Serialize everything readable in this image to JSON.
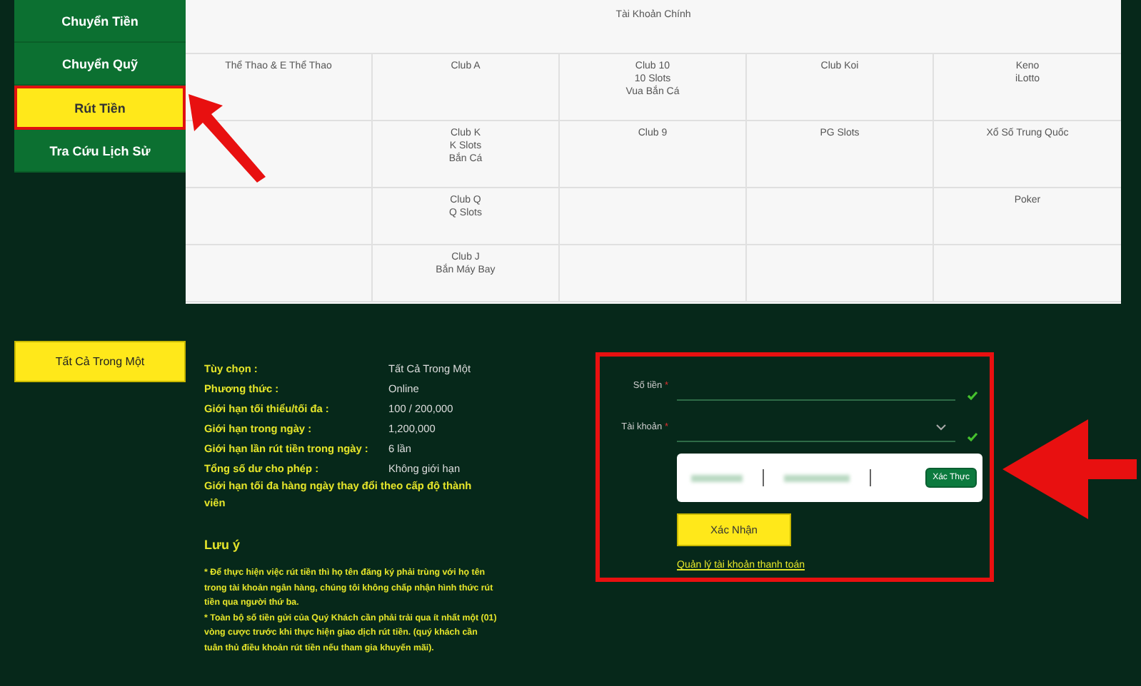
{
  "sidebar": {
    "items": [
      {
        "label": "Chuyển Tiền",
        "selected": false
      },
      {
        "label": "Chuyển Quỹ",
        "selected": false
      },
      {
        "label": "Rút Tiền",
        "selected": true
      },
      {
        "label": "Tra Cứu Lịch Sử",
        "selected": false
      }
    ]
  },
  "wallets": {
    "title": "Tài Khoản Chính",
    "rows": [
      [
        [
          "Thể Thao & E Thể Thao"
        ],
        [
          "Club A"
        ],
        [
          "Club 10",
          "10 Slots",
          "Vua Bắn Cá"
        ],
        [
          "Club Koi"
        ],
        [
          "Keno",
          "iLotto"
        ]
      ],
      [
        [],
        [
          "Club K",
          "K Slots",
          "Bắn Cá"
        ],
        [
          "Club 9"
        ],
        [
          "PG Slots"
        ],
        [
          "Xổ Số Trung Quốc"
        ]
      ],
      [
        [],
        [
          "Club Q",
          "Q Slots"
        ],
        [],
        [],
        [
          "Poker"
        ]
      ],
      [
        [],
        [
          "Club J",
          "Bắn Máy Bay"
        ],
        [],
        [],
        []
      ]
    ]
  },
  "method_button": {
    "label": "Tất Cả Trong Một",
    "selected": true
  },
  "info": {
    "rows": [
      {
        "label": "Tùy chọn :",
        "value": "Tất Cả Trong Một"
      },
      {
        "label": "Phương thức :",
        "value": "Online"
      },
      {
        "label": "Giới hạn tối thiểu/tối đa :",
        "value": "100 / 200,000"
      },
      {
        "label": "Giới hạn trong ngày :",
        "value": "1,200,000"
      },
      {
        "label": "Giới hạn lần rút tiền trong ngày :",
        "value": "6 lần"
      },
      {
        "label": "Tổng số dư cho phép :",
        "value": "Không giới hạn"
      }
    ],
    "note": "Giới hạn tối đa hàng ngày thay đổi theo cấp độ thành viên",
    "notice_title": "Lưu ý",
    "notices": [
      "* Để thực hiện việc rút tiền thì họ tên đăng ký phải trùng với họ tên trong tài khoản ngân hàng, chúng tôi không chấp nhận hình thức rút tiền qua người thứ ba.",
      "* Toàn bộ số tiền gửi của Quý Khách cần phải trải qua ít nhất một (01) vòng cược trước khi thực hiện giao dịch rút tiền. (quý khách cần tuân thủ điều khoản rút tiền nếu tham gia khuyến mãi)."
    ]
  },
  "form": {
    "fields": [
      {
        "kind": "input",
        "label": "Số tiền",
        "required_mark": "*",
        "valid": true
      },
      {
        "kind": "select",
        "label": "Tài khoản",
        "required_mark": "*",
        "valid": true
      }
    ],
    "verify_button": "Xác Thực",
    "submit": "Xác Nhận",
    "link": "Quản lý tài khoản thanh toán"
  }
}
